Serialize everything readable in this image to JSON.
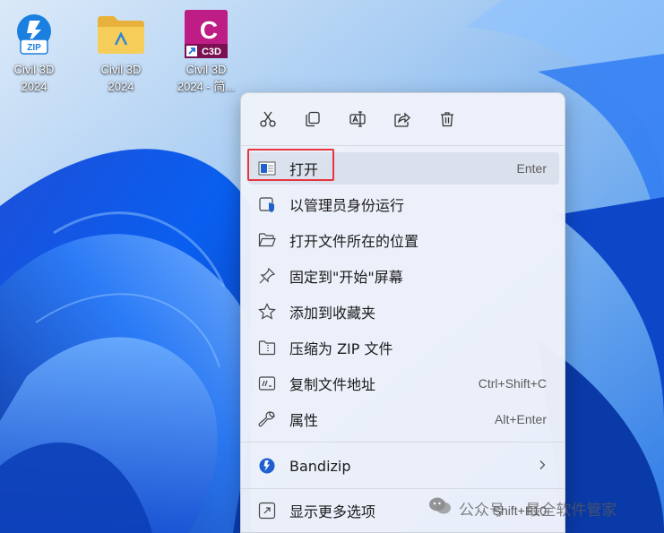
{
  "desktop": {
    "icons": [
      {
        "label_line1": "Civil 3D",
        "label_line2": "2024",
        "icon": "zip-archive-icon"
      },
      {
        "label_line1": "Civil 3D",
        "label_line2": "2024",
        "icon": "folder-icon"
      },
      {
        "label_line1": "Civil 3D",
        "label_line2": "2024 - 简...",
        "icon": "c3d-app-icon",
        "badge": "C3D",
        "letter": "C"
      }
    ],
    "zip_badge": "ZIP"
  },
  "context_menu": {
    "toolbar": [
      "cut-icon",
      "copy-icon",
      "rename-icon",
      "share-icon",
      "delete-icon"
    ],
    "items": [
      {
        "label": "打开",
        "shortcut": "Enter",
        "icon": "open-icon"
      },
      {
        "label": "以管理员身份运行",
        "shortcut": "",
        "icon": "admin-shield-icon"
      },
      {
        "label": "打开文件所在的位置",
        "shortcut": "",
        "icon": "folder-open-icon"
      },
      {
        "label": "固定到\"开始\"屏幕",
        "shortcut": "",
        "icon": "pin-icon"
      },
      {
        "label": "添加到收藏夹",
        "shortcut": "",
        "icon": "star-icon"
      },
      {
        "label": "压缩为 ZIP 文件",
        "shortcut": "",
        "icon": "zip-folder-icon"
      },
      {
        "label": "复制文件地址",
        "shortcut": "Ctrl+Shift+C",
        "icon": "copy-path-icon"
      },
      {
        "label": "属性",
        "shortcut": "Alt+Enter",
        "icon": "wrench-icon"
      },
      {
        "label": "Bandizip",
        "shortcut": "",
        "icon": "bandizip-icon"
      },
      {
        "label": "显示更多选项",
        "shortcut": "Shift+F10",
        "icon": "more-options-icon"
      }
    ]
  },
  "watermark": {
    "left": "公众号",
    "right": "最全软件管家"
  },
  "colors": {
    "highlight_frame": "#e5363f",
    "accent": "#1f5fcf"
  }
}
